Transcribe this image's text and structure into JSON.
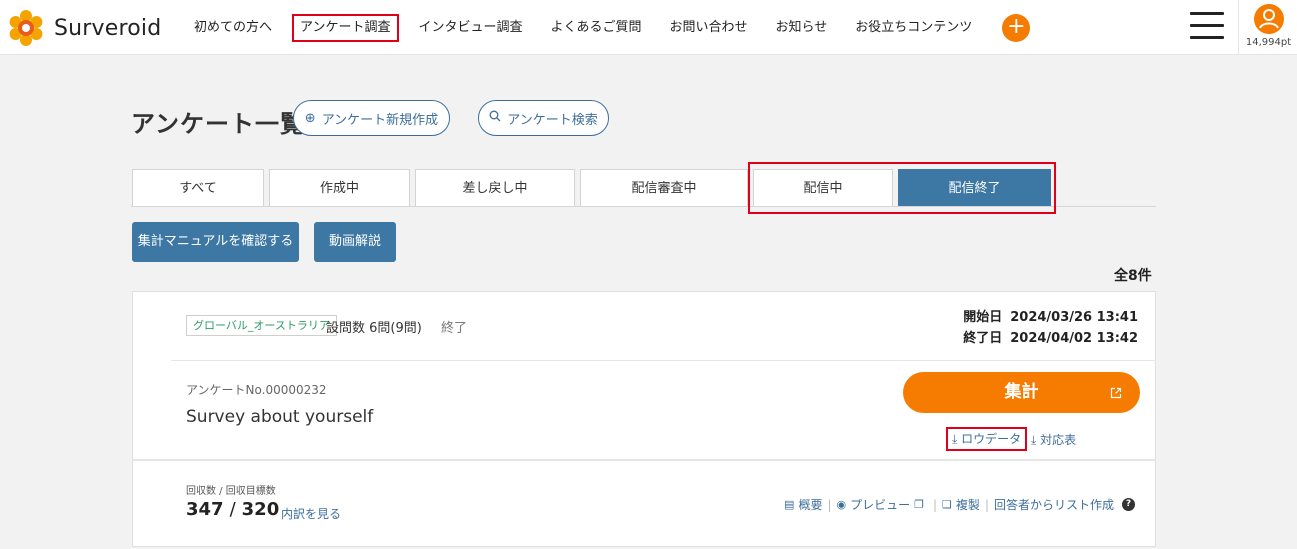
{
  "header": {
    "logo_text": "Surveroid",
    "nav": [
      {
        "label": "初めての方へ"
      },
      {
        "label": "アンケート調査"
      },
      {
        "label": "インタビュー調査"
      },
      {
        "label": "よくあるご質問"
      },
      {
        "label": "お問い合わせ"
      },
      {
        "label": "お知らせ"
      },
      {
        "label": "お役立ちコンテンツ"
      }
    ],
    "plus_icon": "+",
    "points": "14,994pt"
  },
  "page": {
    "title": "アンケート一覧",
    "new_survey_label": "アンケート新規作成",
    "search_survey_label": "アンケート検索"
  },
  "tabs": [
    {
      "label": "すべて"
    },
    {
      "label": "作成中"
    },
    {
      "label": "差し戻し中"
    },
    {
      "label": "配信審査中"
    },
    {
      "label": "配信中"
    },
    {
      "label": "配信終了"
    }
  ],
  "actions": {
    "manual_label": "集計マニュアルを確認する",
    "video_label": "動画解説"
  },
  "total_count": "全8件",
  "card": {
    "tag": "グローバル_オーストラリア",
    "question_count": "設問数 6問(9問)",
    "status": "終了",
    "start_label": "開始日",
    "start_value": "2024/03/26 13:41",
    "end_label": "終了日",
    "end_value": "2024/04/02 13:42",
    "survey_no": "アンケートNo.00000232",
    "survey_title": "Survey about yourself",
    "aggregate_label": "集計",
    "rawdata_label": "ロウデータ",
    "table_label": "対応表",
    "collect_label": "回収数 / 回収目標数",
    "collected": "347",
    "slash": "/",
    "target": "320",
    "detail_label": "内訳を見る",
    "links": {
      "overview": "概要",
      "preview": "プレビュー",
      "duplicate": "複製",
      "list_create": "回答者からリスト作成"
    }
  },
  "colors": {
    "accent_orange": "#f57c00",
    "primary_blue": "#3d77a3",
    "highlight_red": "#e0001a",
    "tag_green": "#2e9a6a"
  },
  "icons": {
    "logo": "surveroid-flower-logo",
    "new": "plus-circle-icon",
    "search": "search-icon",
    "external": "external-link-icon",
    "download": "download-icon",
    "overview": "document-icon",
    "preview": "eye-icon",
    "copy": "copy-icon",
    "help": "help-icon",
    "menu": "hamburger-icon",
    "user": "user-icon"
  }
}
